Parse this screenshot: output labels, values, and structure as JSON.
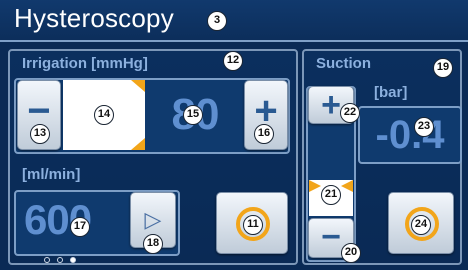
{
  "header": {
    "title": "Hysteroscopy"
  },
  "irrigation": {
    "label": "Irrigation [mmHg]",
    "pressure_value": "80",
    "minus_label": "−",
    "plus_label": "+",
    "flow_unit": "[ml/min]",
    "flow_value": "600",
    "play_label": "▷",
    "pages": {
      "count": 3,
      "active": 3
    }
  },
  "suction": {
    "label": "Suction",
    "unit": "[bar]",
    "value": "-0.4",
    "plus_label": "+",
    "minus_label": "−"
  },
  "callouts": {
    "c3": "3",
    "c11": "11",
    "c12": "12",
    "c13": "13",
    "c14": "14",
    "c15": "15",
    "c16": "16",
    "c17": "17",
    "c18": "18",
    "c19": "19",
    "c20": "20",
    "c21": "21",
    "c22": "22",
    "c23": "23",
    "c24": "24"
  },
  "colors": {
    "background": "#0a2a55",
    "section_label": "#8cb0de",
    "value_text": "#5f8fd0",
    "slider_marker": "#f2a51a",
    "start_ring": "#f2a51a"
  },
  "icons": {
    "start": "power-ring-icon",
    "play": "play-icon",
    "slider_marker": "triangle-marker-icon"
  }
}
